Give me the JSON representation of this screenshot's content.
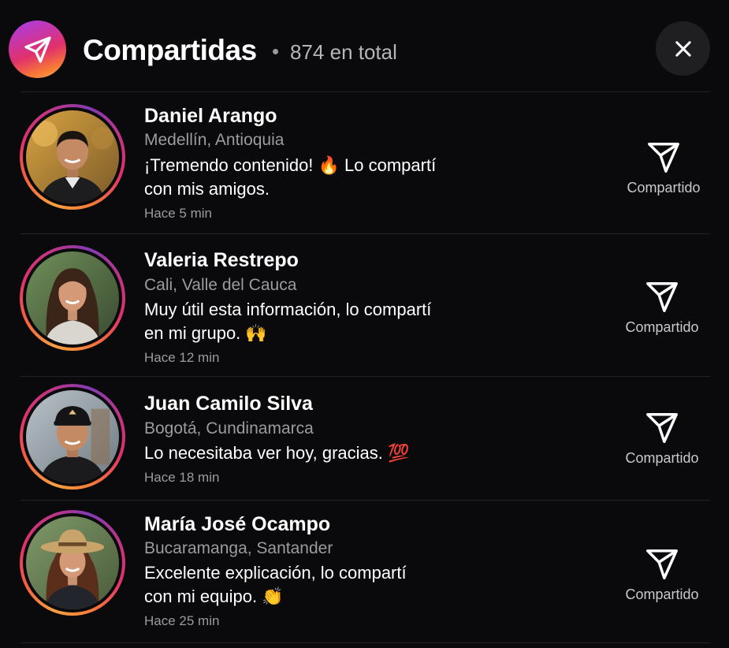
{
  "header": {
    "title": "Compartidas",
    "separator": "•",
    "count_text": "874 en total",
    "logo_icon": "send-icon",
    "close_icon": "close-icon"
  },
  "colors": {
    "background": "#0a0a0c",
    "ring_gradient": [
      "#833ab4",
      "#c13584",
      "#e1306c",
      "#f56040",
      "#f9a03f"
    ],
    "secondary_text": "#9b9ba0"
  },
  "shares": [
    {
      "name": "Daniel Arango",
      "location": "Medellín, Antioquia",
      "message_line1": "¡Tremendo contenido! 🔥 Lo compartí",
      "message_line2": "con mis amigos.",
      "time": "Hace 5 min",
      "action_label": "Compartido",
      "action_icon": "send-icon"
    },
    {
      "name": "Valeria Restrepo",
      "location": "Cali, Valle del Cauca",
      "message_line1": "Muy útil esta información, lo compartí",
      "message_line2": "en mi grupo. 🙌",
      "time": "Hace 12 min",
      "action_label": "Compartido",
      "action_icon": "send-icon"
    },
    {
      "name": "Juan Camilo Silva",
      "location": "Bogotá, Cundinamarca",
      "message_line1": "Lo necesitaba ver hoy, gracias. 💯",
      "message_line2": "",
      "time": "Hace 18 min",
      "action_label": "Compartido",
      "action_icon": "send-icon"
    },
    {
      "name": "María José Ocampo",
      "location": "Bucaramanga, Santander",
      "message_line1": "Excelente explicación, lo compartí",
      "message_line2": "con mi equipo. 👏",
      "time": "Hace 25 min",
      "action_label": "Compartido",
      "action_icon": "send-icon"
    }
  ]
}
